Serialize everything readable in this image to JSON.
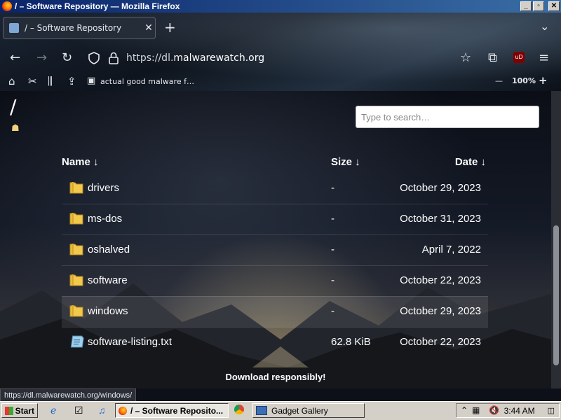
{
  "window": {
    "title": "/ – Software Repository — Mozilla Firefox",
    "controls": {
      "minimize": "_",
      "maximize": "▫",
      "close": "✕"
    }
  },
  "tab": {
    "label": "/ – Software Repository",
    "close": "✕"
  },
  "new_tab": "+",
  "tab_list": "⌄",
  "nav": {
    "back": "←",
    "forward": "→",
    "reload": "↻",
    "url_prefix": "https://dl.",
    "url_domain": "malwarewatch.org",
    "star": "☆",
    "extensions": "⧉",
    "ublock": "uD",
    "menu": "≡"
  },
  "bookmarks": {
    "item": "actual good malware f…",
    "zoom_out": "—",
    "zoom": "100%",
    "zoom_in": "+"
  },
  "page": {
    "breadcrumb": "/",
    "search_placeholder": "Type to search…",
    "columns": {
      "name": "Name ↓",
      "size": "Size ↓",
      "date": "Date ↓"
    },
    "rows": [
      {
        "name": "drivers",
        "size": "-",
        "date": "October 29, 2023",
        "type": "folder"
      },
      {
        "name": "ms-dos",
        "size": "-",
        "date": "October 31, 2023",
        "type": "folder"
      },
      {
        "name": "oshalved",
        "size": "-",
        "date": "April 7, 2022",
        "type": "folder"
      },
      {
        "name": "software",
        "size": "-",
        "date": "October 22, 2023",
        "type": "folder"
      },
      {
        "name": "windows",
        "size": "-",
        "date": "October 29, 2023",
        "type": "folder"
      },
      {
        "name": "software-listing.txt",
        "size": "62.8 KiB",
        "date": "October 22, 2023",
        "type": "file"
      }
    ],
    "footer": "Download responsibly!",
    "status_url": "https://dl.malwarewatch.org/windows/"
  },
  "taskbar": {
    "start": "Start",
    "firefox_task": "/ – Software Reposito...",
    "gadget_task": "Gadget Gallery",
    "clock": "3:44 AM"
  },
  "colors": {
    "folder": "#f2c94c",
    "accent": "#0a246a"
  }
}
